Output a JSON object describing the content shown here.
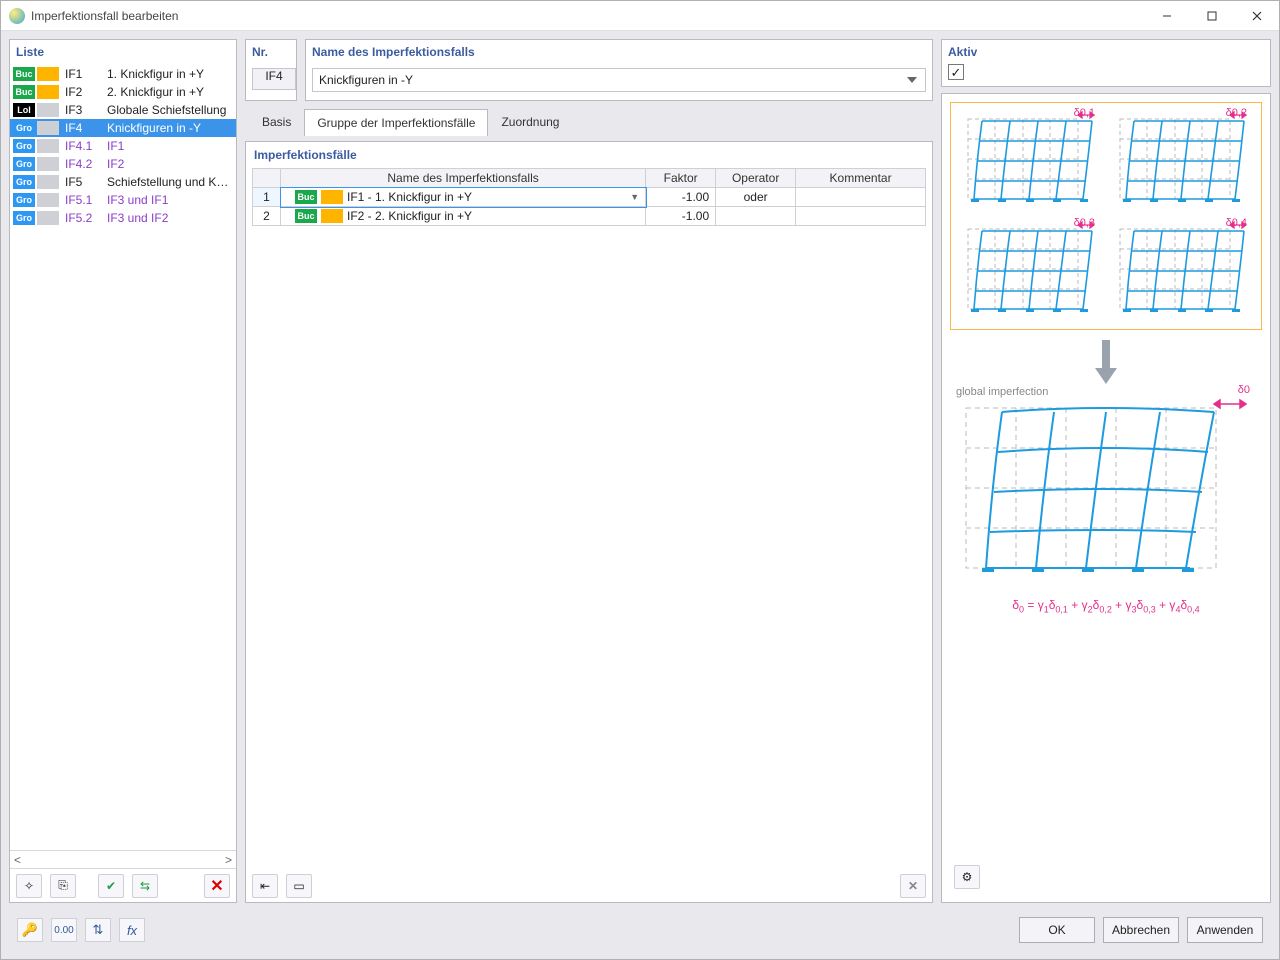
{
  "window": {
    "title": "Imperfektionsfall bearbeiten"
  },
  "left": {
    "heading": "Liste",
    "items": [
      {
        "sw1": "Buc",
        "c1": "#1ba84a",
        "sw2": "",
        "c2": "#ffb400",
        "id": "IF1",
        "name": "1. Knickfigur in +Y",
        "sub": false
      },
      {
        "sw1": "Buc",
        "c1": "#1ba84a",
        "sw2": "",
        "c2": "#ffb400",
        "id": "IF2",
        "name": "2. Knickfigur in +Y",
        "sub": false
      },
      {
        "sw1": "Lol",
        "c1": "#000000",
        "sw2": "",
        "c2": "empty",
        "id": "IF3",
        "name": "Globale Schiefstellung",
        "sub": false
      },
      {
        "sw1": "Gro",
        "c1": "#2e97f2",
        "sw2": "",
        "c2": "empty",
        "id": "IF4",
        "name": "Knickfiguren in -Y",
        "sub": false,
        "selected": true
      },
      {
        "sw1": "Gro",
        "c1": "#2e97f2",
        "sw2": "",
        "c2": "empty",
        "id": "IF4.1",
        "name": "IF1",
        "sub": true
      },
      {
        "sw1": "Gro",
        "c1": "#2e97f2",
        "sw2": "",
        "c2": "empty",
        "id": "IF4.2",
        "name": "IF2",
        "sub": true
      },
      {
        "sw1": "Gro",
        "c1": "#2e97f2",
        "sw2": "",
        "c2": "empty",
        "id": "IF5",
        "name": "Schiefstellung und Knickfig",
        "sub": false
      },
      {
        "sw1": "Gro",
        "c1": "#2e97f2",
        "sw2": "",
        "c2": "empty",
        "id": "IF5.1",
        "name": "IF3 und IF1",
        "sub": true
      },
      {
        "sw1": "Gro",
        "c1": "#2e97f2",
        "sw2": "",
        "c2": "empty",
        "id": "IF5.2",
        "name": "IF3 und IF2",
        "sub": true
      }
    ]
  },
  "header": {
    "nr_label": "Nr.",
    "nr_value": "IF4",
    "name_label": "Name des Imperfektionsfalls",
    "name_value": "Knickfiguren in -Y",
    "active_label": "Aktiv",
    "active_checked": true
  },
  "tabs": {
    "items": [
      "Basis",
      "Gruppe der Imperfektionsfälle",
      "Zuordnung"
    ],
    "active": 1
  },
  "grid": {
    "title": "Imperfektionsfälle",
    "columns": [
      "",
      "Name des Imperfektionsfalls",
      "Faktor",
      "Operator",
      "Kommentar"
    ],
    "rows": [
      {
        "n": "1",
        "sw1": "Buc",
        "c1": "#1ba84a",
        "c2": "#ffb400",
        "name": "IF1 - 1. Knickfigur in +Y",
        "factor": "-1.00",
        "op": "oder",
        "comment": "",
        "selected": true
      },
      {
        "n": "2",
        "sw1": "Buc",
        "c1": "#1ba84a",
        "c2": "#ffb400",
        "name": "IF2 - 2. Knickfigur in +Y",
        "factor": "-1.00",
        "op": "",
        "comment": ""
      }
    ]
  },
  "diagram": {
    "deltas": [
      "δ0,1",
      "δ0,2",
      "δ0,3",
      "δ0,4"
    ],
    "global_label": "global imperfection",
    "global_delta": "δ0",
    "formula_html": "δ<sub>0</sub> = γ<sub>1</sub>δ<sub>0,1</sub> + γ<sub>2</sub>δ<sub>0,2</sub> + γ<sub>3</sub>δ<sub>0,3</sub> + γ<sub>4</sub>δ<sub>0,4</sub>"
  },
  "footer": {
    "ok": "OK",
    "cancel": "Abbrechen",
    "apply": "Anwenden"
  }
}
